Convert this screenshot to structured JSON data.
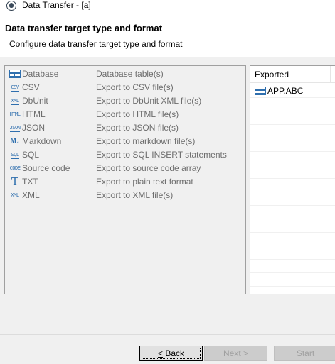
{
  "window": {
    "title": "Data Transfer - [a]"
  },
  "header": {
    "title": "Data transfer target type and format",
    "description": "Configure data transfer target type and format"
  },
  "processors": [
    {
      "name": "Database",
      "description": "Database table(s)",
      "icon": "database-table-icon"
    },
    {
      "name": "CSV",
      "description": "Export to CSV file(s)",
      "icon": "csv-file-icon"
    },
    {
      "name": "DbUnit",
      "description": "Export to DbUnit XML file(s)",
      "icon": "xml-file-icon"
    },
    {
      "name": "HTML",
      "description": "Export to HTML file(s)",
      "icon": "html-file-icon"
    },
    {
      "name": "JSON",
      "description": "Export to JSON file(s)",
      "icon": "json-file-icon"
    },
    {
      "name": "Markdown",
      "description": "Export to markdown file(s)",
      "icon": "markdown-icon"
    },
    {
      "name": "SQL",
      "description": "Export to SQL INSERT statements",
      "icon": "sql-file-icon"
    },
    {
      "name": "Source code",
      "description": "Export to source code array",
      "icon": "code-file-icon"
    },
    {
      "name": "TXT",
      "description": "Export to plain text format",
      "icon": "text-icon"
    },
    {
      "name": "XML",
      "description": "Export to XML file(s)",
      "icon": "xml-file-icon"
    }
  ],
  "icon_text": {
    "csv": "CSV",
    "xml": "XML",
    "html": "HTML",
    "json": "JSON",
    "markdown": "M↓",
    "sql": "SQL",
    "code": "CODE",
    "txt": "T"
  },
  "exported": {
    "header": "Exported",
    "items": [
      {
        "label": "APP.ABC",
        "icon": "database-table-icon"
      }
    ]
  },
  "buttons": {
    "back_mnemonic": "<",
    "back_label": " Back",
    "next": "Next >",
    "start": "Start"
  },
  "colors": {
    "icon_accent": "#2f6fae",
    "disabled_text": "#6d6d6d"
  }
}
